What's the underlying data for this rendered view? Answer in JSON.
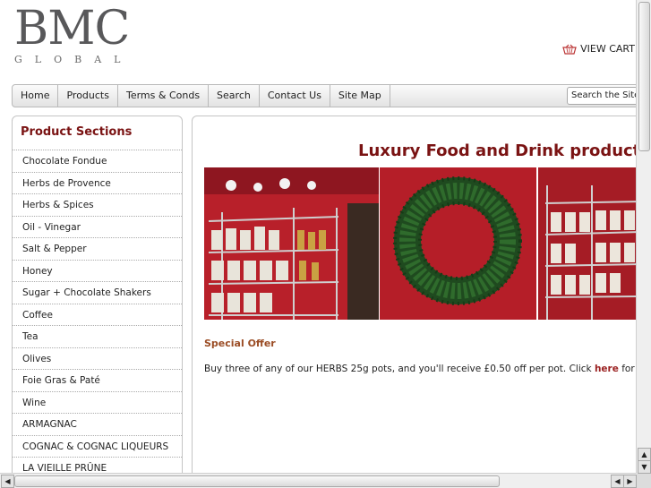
{
  "logo": {
    "big": "BMC",
    "small": "GLOBAL"
  },
  "cart": {
    "label": "VIEW CART",
    "icon": "basket-icon"
  },
  "nav": {
    "items": [
      "Home",
      "Products",
      "Terms & Conds",
      "Search",
      "Contact Us",
      "Site Map"
    ]
  },
  "search": {
    "placeholder": "Search the Site"
  },
  "sidebar": {
    "title": "Product Sections",
    "items": [
      "Chocolate Fondue",
      "Herbs de Provence",
      "Herbs & Spices",
      "Oil - Vinegar",
      "Salt & Pepper",
      "Honey",
      "Sugar + Chocolate Shakers",
      "Coffee",
      "Tea",
      "Olives",
      "Foie Gras & Paté",
      "Wine",
      "ARMAGNAC",
      "COGNAC & COGNAC LIQUEURS",
      "LA VIEILLE PRÛNE"
    ]
  },
  "main": {
    "heading": "Luxury Food and Drink products",
    "offer_title": "Special Offer",
    "offer_text": "Buy three of any of our HERBS 25g pots, and you'll receive £0.50 off per pot. Click ",
    "offer_link": "here",
    "offer_after": " for more."
  },
  "colors": {
    "heading": "#7a1313",
    "offer": "#9b4d25",
    "shop_wall": "#b8202a"
  }
}
